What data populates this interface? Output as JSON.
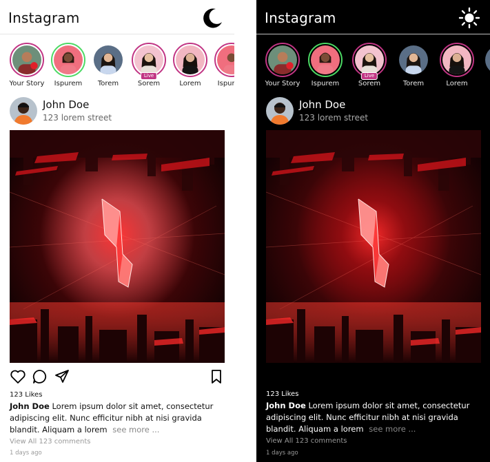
{
  "app": {
    "title": "Instagram"
  },
  "theme_icons": {
    "light_panel": "moon-icon",
    "dark_panel": "sun-icon"
  },
  "colors": {
    "story_ring": "#c13584",
    "story_ring_viewed": "#4cd964",
    "live_badge": "#c13584",
    "dark_bg": "#000000",
    "light_bg": "#ffffff"
  },
  "light": {
    "stories": [
      {
        "name": "Your Story",
        "ring": "pink",
        "live": false,
        "avatar": "avatar-1"
      },
      {
        "name": "Ispurem",
        "ring": "green",
        "live": false,
        "avatar": "avatar-2"
      },
      {
        "name": "Torem",
        "ring": "none",
        "live": false,
        "avatar": "avatar-3"
      },
      {
        "name": "Sorem",
        "ring": "pink",
        "live": true,
        "avatar": "avatar-4"
      },
      {
        "name": "Lorem",
        "ring": "pink",
        "live": false,
        "avatar": "avatar-5"
      },
      {
        "name": "Ispurem",
        "ring": "pink",
        "live": false,
        "avatar": "avatar-2"
      }
    ]
  },
  "dark": {
    "stories": [
      {
        "name": "Your Story",
        "ring": "pink",
        "live": false,
        "avatar": "avatar-1"
      },
      {
        "name": "Ispurem",
        "ring": "green",
        "live": false,
        "avatar": "avatar-2"
      },
      {
        "name": "Sorem",
        "ring": "pink",
        "live": true,
        "avatar": "avatar-4"
      },
      {
        "name": "Torem",
        "ring": "none",
        "live": false,
        "avatar": "avatar-3"
      },
      {
        "name": "Lorem",
        "ring": "pink",
        "live": false,
        "avatar": "avatar-5"
      }
    ]
  },
  "live_label": "Live",
  "post": {
    "username": "John Doe",
    "location": "123 lorem street",
    "likes": "123 Likes",
    "caption_user": "John Doe",
    "caption_text": "Lorem ipsum dolor sit amet, consectetur adipiscing elit. Nunc efficitur nibh at nisi gravida blandit. Aliquam a lorem",
    "see_more": "see more ...",
    "comments_link": "View All 123 comments",
    "time": "1 days ago"
  }
}
